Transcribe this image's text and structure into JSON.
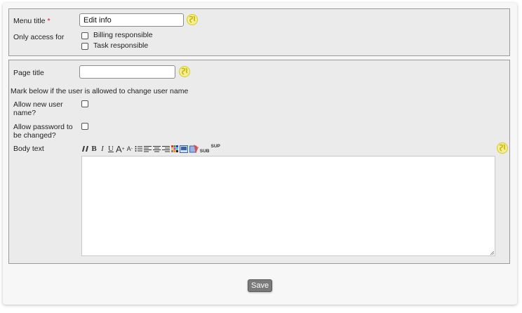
{
  "menu": {
    "title_label": "Menu title",
    "required_mark": "*",
    "title_value": "Edit info",
    "access_label": "Only access for",
    "access_options": [
      {
        "label": "Billing responsible",
        "checked": false
      },
      {
        "label": "Task responsible",
        "checked": false
      }
    ]
  },
  "page": {
    "title_label": "Page title",
    "title_value": "",
    "username_note": "Mark below if the user is allowed to change user name",
    "allow_username_label": "Allow new user name?",
    "allow_password_label": "Allow password to be changed?",
    "body_label": "Body text",
    "toolbar": {
      "bold": "B",
      "italic": "I",
      "underline": "U",
      "font_size_up": "A",
      "font_size_down": "A",
      "subscript": "SUB",
      "superscript": "SUP"
    }
  },
  "actions": {
    "save_label": "Save"
  },
  "colors": {
    "globe_yellow": "#e8dc26",
    "panel_bg": "#ebebeb",
    "border": "#9a9a9a"
  }
}
